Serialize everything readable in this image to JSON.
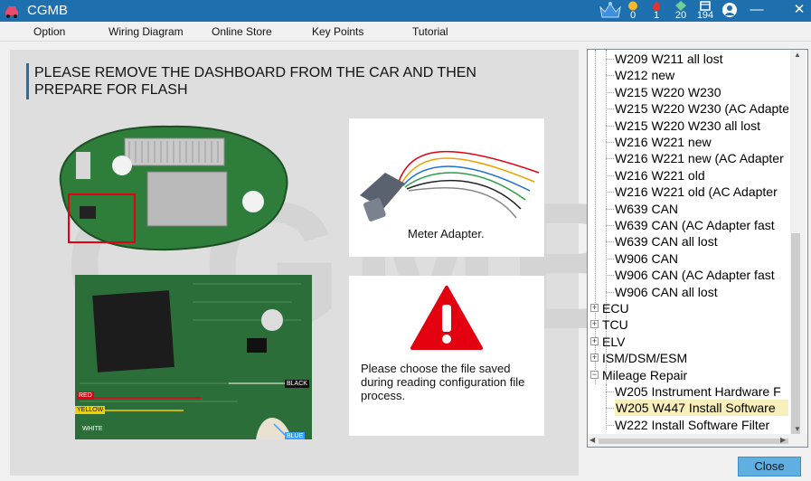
{
  "window": {
    "title": "CGMB",
    "stats": [
      {
        "icon": "coin-icon",
        "value": "0",
        "color": "#f5b82e"
      },
      {
        "icon": "fire-icon",
        "value": "1",
        "color": "#e8322f"
      },
      {
        "icon": "diamond-icon",
        "value": "20",
        "color": "#6fcf97"
      },
      {
        "icon": "box-icon",
        "value": "194",
        "color": "#ffffff"
      }
    ],
    "minimize": "—",
    "close": "✕"
  },
  "menu": {
    "items": [
      "Option",
      "Wiring Diagram",
      "Online Store",
      "Key Points",
      "Tutorial"
    ]
  },
  "content": {
    "watermark": "CGMB",
    "instruction": "PLEASE REMOVE THE DASHBOARD FROM THE CAR AND THEN PREPARE FOR FLASH",
    "adapter_caption": "Meter Adapter.",
    "warning_text": "Please choose the file saved during reading configuration file process.",
    "wire_labels": {
      "red": "RED",
      "yellow": "YELLOW",
      "white": "WHITE",
      "black": "BLACK",
      "blue": "BLUE"
    }
  },
  "tree": {
    "items": [
      {
        "label": "W209 W211 all lost",
        "level": 2
      },
      {
        "label": "W212 new",
        "level": 2
      },
      {
        "label": "W215 W220 W230",
        "level": 2
      },
      {
        "label": "W215 W220 W230 (AC Adapter",
        "level": 2
      },
      {
        "label": "W215 W220 W230 all lost",
        "level": 2
      },
      {
        "label": "W216 W221 new",
        "level": 2
      },
      {
        "label": "W216 W221 new (AC Adapter",
        "level": 2
      },
      {
        "label": "W216 W221 old",
        "level": 2
      },
      {
        "label": "W216 W221 old (AC Adapter",
        "level": 2
      },
      {
        "label": "W639 CAN",
        "level": 2
      },
      {
        "label": "W639 CAN (AC Adapter fast",
        "level": 2
      },
      {
        "label": "W639 CAN all lost",
        "level": 2
      },
      {
        "label": "W906 CAN",
        "level": 2
      },
      {
        "label": "W906 CAN (AC Adapter fast",
        "level": 2
      },
      {
        "label": "W906 CAN all lost",
        "level": 2
      },
      {
        "label": "ECU",
        "level": 1,
        "expander": "+"
      },
      {
        "label": "TCU",
        "level": 1,
        "expander": "+"
      },
      {
        "label": "ELV",
        "level": 1,
        "expander": "+"
      },
      {
        "label": "ISM/DSM/ESM",
        "level": 1,
        "expander": "+"
      },
      {
        "label": "Mileage Repair",
        "level": 1,
        "expander": "−"
      },
      {
        "label": "W205 Instrument Hardware F",
        "level": 2
      },
      {
        "label": "W205 W447 Install Software",
        "level": 2,
        "selected": true
      },
      {
        "label": "W222 Install Software Filter",
        "level": 2
      }
    ]
  },
  "footer": {
    "close_label": "Close"
  },
  "colors": {
    "accent": "#1e6fae",
    "selection": "#f8efba",
    "close_button": "#5fb0e0",
    "warning_red": "#e3000f"
  }
}
